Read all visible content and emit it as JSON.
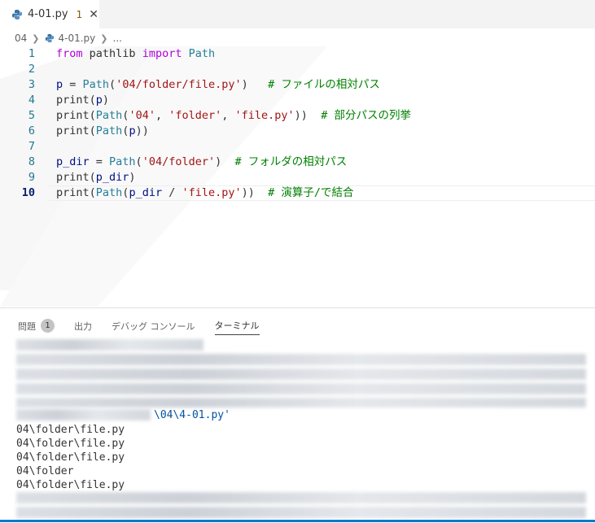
{
  "tab": {
    "filename": "4-01.py",
    "problems_count": "1",
    "close_glyph": "✕"
  },
  "breadcrumb": {
    "folder": "04",
    "file": "4-01.py",
    "more": "..."
  },
  "editor": {
    "active_line": 10,
    "lines": [
      {
        "num": "1",
        "tokens": [
          [
            "kw",
            "from"
          ],
          [
            "plain",
            " "
          ],
          [
            "plain",
            "pathlib"
          ],
          [
            "plain",
            " "
          ],
          [
            "kw",
            "import"
          ],
          [
            "plain",
            " "
          ],
          [
            "fn",
            "Path"
          ]
        ]
      },
      {
        "num": "2",
        "tokens": []
      },
      {
        "num": "3",
        "tokens": [
          [
            "var",
            "p"
          ],
          [
            "plain",
            " = "
          ],
          [
            "fn",
            "Path"
          ],
          [
            "plain",
            "("
          ],
          [
            "str",
            "'04/folder/file.py'"
          ],
          [
            "plain",
            ")   "
          ],
          [
            "cmt",
            "# ファイルの相対パス"
          ]
        ]
      },
      {
        "num": "4",
        "tokens": [
          [
            "plain",
            "print("
          ],
          [
            "var",
            "p"
          ],
          [
            "plain",
            ")"
          ]
        ]
      },
      {
        "num": "5",
        "tokens": [
          [
            "plain",
            "print("
          ],
          [
            "fn",
            "Path"
          ],
          [
            "plain",
            "("
          ],
          [
            "str",
            "'04'"
          ],
          [
            "plain",
            ", "
          ],
          [
            "str",
            "'folder'"
          ],
          [
            "plain",
            ", "
          ],
          [
            "str",
            "'file.py'"
          ],
          [
            "plain",
            "))  "
          ],
          [
            "cmt",
            "# 部分パスの列挙"
          ]
        ]
      },
      {
        "num": "6",
        "tokens": [
          [
            "plain",
            "print("
          ],
          [
            "fn",
            "Path"
          ],
          [
            "plain",
            "("
          ],
          [
            "var",
            "p"
          ],
          [
            "plain",
            "))"
          ]
        ]
      },
      {
        "num": "7",
        "tokens": []
      },
      {
        "num": "8",
        "tokens": [
          [
            "var",
            "p_dir"
          ],
          [
            "plain",
            " = "
          ],
          [
            "fn",
            "Path"
          ],
          [
            "plain",
            "("
          ],
          [
            "str",
            "'04/folder'"
          ],
          [
            "plain",
            ")  "
          ],
          [
            "cmt",
            "# フォルダの相対パス"
          ]
        ]
      },
      {
        "num": "9",
        "tokens": [
          [
            "plain",
            "print("
          ],
          [
            "var",
            "p_dir"
          ],
          [
            "plain",
            ")"
          ]
        ]
      },
      {
        "num": "10",
        "tokens": [
          [
            "plain",
            "print("
          ],
          [
            "fn",
            "Path"
          ],
          [
            "plain",
            "("
          ],
          [
            "var",
            "p_dir"
          ],
          [
            "plain",
            " / "
          ],
          [
            "str",
            "'file.py'"
          ],
          [
            "plain",
            "))  "
          ],
          [
            "cmt",
            "# 演算子/で結合"
          ]
        ]
      }
    ]
  },
  "panel": {
    "tabs": {
      "problems": "問題",
      "output": "出力",
      "debug_console": "デバッグ コンソール",
      "terminal": "ターミナル"
    },
    "terminal": {
      "path_suffix": "\\04\\4-01.py'",
      "output": [
        "04\\folder\\file.py",
        "04\\folder\\file.py",
        "04\\folder\\file.py",
        "04\\folder",
        "04\\folder\\file.py"
      ]
    }
  },
  "colors": {
    "accent": "#007acc",
    "keyword": "#af00db",
    "class": "#267f99",
    "string": "#a31515",
    "comment": "#008000"
  }
}
